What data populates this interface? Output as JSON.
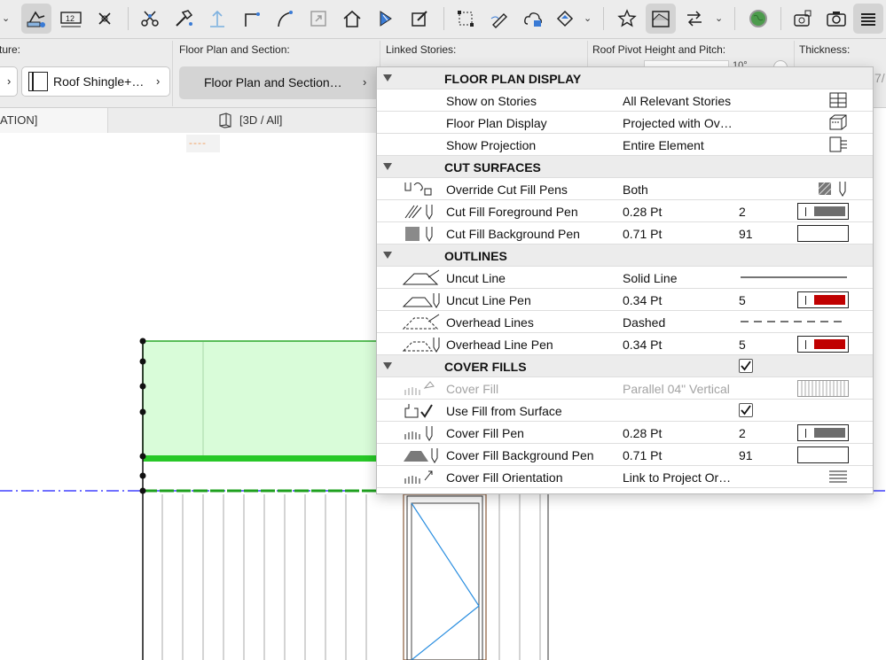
{
  "toolbar": {
    "icons": [
      "arrange-pointer-icon",
      "dimension-ruler-icon",
      "marker-icon",
      "scissors-icon",
      "hammer-icon",
      "elevate-icon",
      "corner-icon",
      "curve-icon",
      "export-icon",
      "home-icon",
      "diamond-sheet-icon",
      "edit-doc-icon",
      "selection-box-icon",
      "pen-tool-icon",
      "cloud-action-icon",
      "fill-bucket-icon",
      "favorites-star-icon",
      "floorplan-view-icon",
      "swap-icon",
      "globe-icon",
      "layers-camera-icon",
      "camera-icon",
      "stack-icon"
    ]
  },
  "infobar": {
    "labels": {
      "structure": "ture:",
      "floor_plan_section": "Floor Plan and Section:",
      "linked_stories": "Linked Stories:",
      "roof_pivot": "Roof Pivot Height and Pitch:",
      "thickness": "Thickness:"
    },
    "roof_button": "Roof Shingle+…",
    "fps_button": "Floor Plan and Section…",
    "partial_pitch": "10°",
    "partial_thickness": "7/"
  },
  "tabs": {
    "left": "ATION]",
    "view3d": "[3D / All]",
    "dashes": "----"
  },
  "panel": {
    "sections": [
      {
        "title": "FLOOR PLAN DISPLAY",
        "rows": [
          {
            "label": "Show on Stories",
            "value": "All Relevant Stories",
            "num": "",
            "right": "stories-icon"
          },
          {
            "label": "Floor Plan Display",
            "value": "Projected with Ov…",
            "num": "",
            "right": "projection-icon"
          },
          {
            "label": "Show Projection",
            "value": "Entire Element",
            "num": "",
            "right": "show-projection-icon"
          }
        ]
      },
      {
        "title": "CUT SURFACES",
        "rows": [
          {
            "label": "Override Cut Fill Pens",
            "value": "Both",
            "num": "",
            "right": "override-icon"
          },
          {
            "label": "Cut Fill Foreground Pen",
            "value": "0.28 Pt",
            "num": "2",
            "right": "pen-swatch",
            "pen_color": "#6d6d6d"
          },
          {
            "label": "Cut Fill Background Pen",
            "value": "0.71 Pt",
            "num": "91",
            "right": "pen-swatch-empty"
          }
        ]
      },
      {
        "title": "OUTLINES",
        "rows": [
          {
            "label": "Uncut Line",
            "value": "Solid Line",
            "num": "",
            "right": "solid-line"
          },
          {
            "label": "Uncut Line Pen",
            "value": "0.34 Pt",
            "num": "5",
            "right": "pen-swatch",
            "pen_color": "#c00000"
          },
          {
            "label": "Overhead Lines",
            "value": "Dashed",
            "num": "",
            "right": "dashed-line"
          },
          {
            "label": "Overhead Line Pen",
            "value": "0.34 Pt",
            "num": "5",
            "right": "pen-swatch",
            "pen_color": "#c00000"
          }
        ]
      },
      {
        "title": "COVER FILLS",
        "checked": true,
        "rows": [
          {
            "label": "Cover Fill",
            "value": "Parallel 04\" Vertical",
            "num": "",
            "right": "vertical-fill-swatch",
            "disabled": true
          },
          {
            "label": "Use Fill from Surface",
            "value": "",
            "num": "",
            "right": "checkbox",
            "checked": true
          },
          {
            "label": "Cover Fill Pen",
            "value": "0.28 Pt",
            "num": "2",
            "right": "pen-swatch",
            "pen_color": "#6d6d6d"
          },
          {
            "label": "Cover Fill Background Pen",
            "value": "0.71 Pt",
            "num": "91",
            "right": "pen-swatch-empty"
          },
          {
            "label": "Cover Fill Orientation",
            "value": "Link to Project Or…",
            "num": "",
            "right": "orientation-icon"
          }
        ]
      }
    ]
  },
  "colors": {
    "accent_green": "#00b800",
    "selection_fill": "#d9fcd9",
    "pen_red": "#c00000",
    "pen_gray": "#6d6d6d",
    "axis_blue": "#1a1aff",
    "toolbar_bg": "#ececec"
  }
}
